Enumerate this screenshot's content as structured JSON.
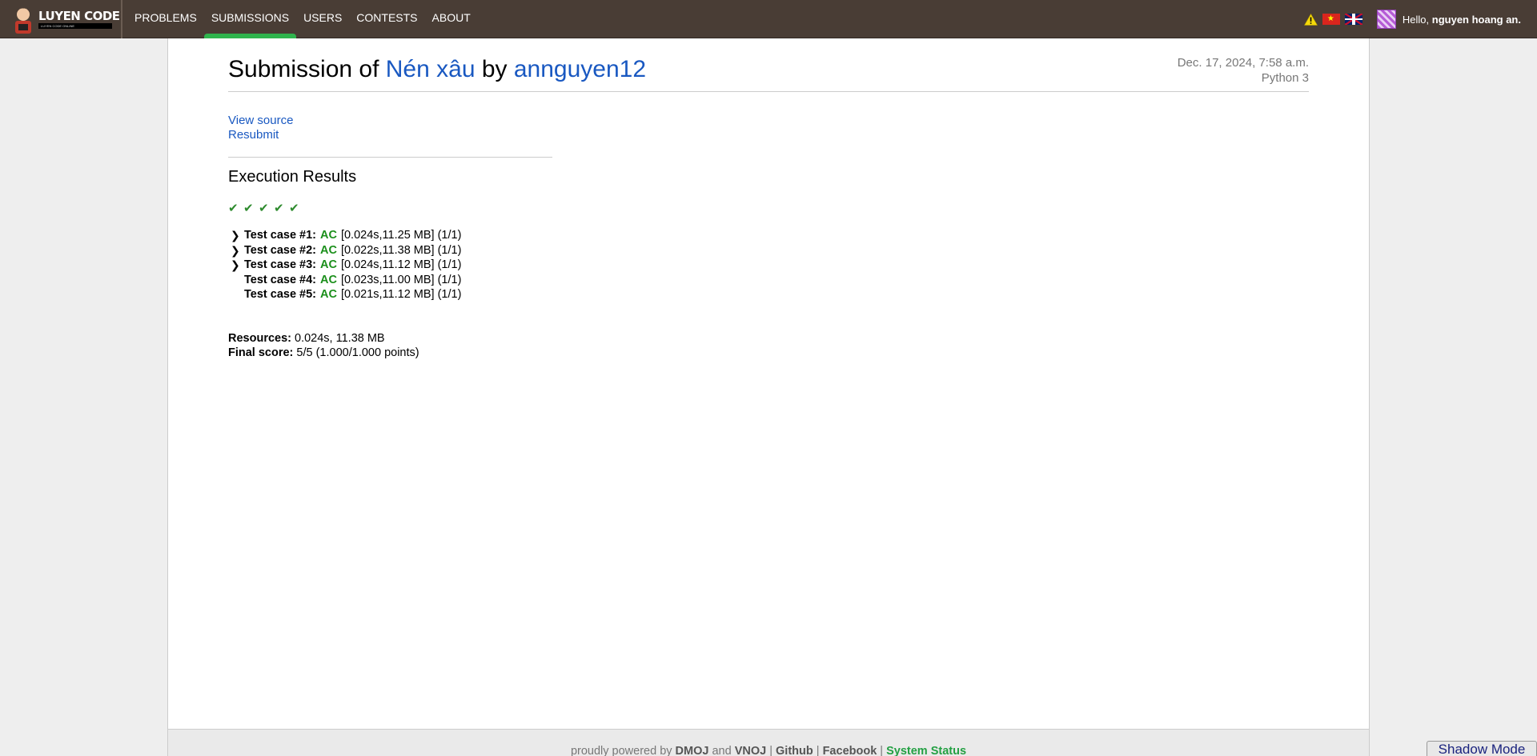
{
  "navbar": {
    "logo_title": "LUYEN CODE",
    "logo_tagline": "LUYEN CODE ONLINE",
    "links": [
      {
        "label": "PROBLEMS"
      },
      {
        "label": "SUBMISSIONS"
      },
      {
        "label": "USERS"
      },
      {
        "label": "CONTESTS"
      },
      {
        "label": "ABOUT"
      }
    ],
    "active_link": "SUBMISSIONS",
    "accent_color": "#2fb44d",
    "greeting_prefix": "Hello, ",
    "username": "nguyen hoang an."
  },
  "submission": {
    "title_prefix": "Submission of ",
    "problem_name": "Nén xâu",
    "title_by": " by ",
    "author": "annguyen12",
    "date": "Dec. 17, 2024, 7:58 a.m.",
    "language": "Python 3",
    "view_source": "View source",
    "resubmit": "Resubmit"
  },
  "results": {
    "heading": "Execution Results",
    "check_count": 5,
    "cases": [
      {
        "label": "Test case #1:",
        "status": "AC",
        "detail": "[0.024s,11.25 MB] (1/1)",
        "expandable": true
      },
      {
        "label": "Test case #2:",
        "status": "AC",
        "detail": "[0.022s,11.38 MB] (1/1)",
        "expandable": true
      },
      {
        "label": "Test case #3:",
        "status": "AC",
        "detail": "[0.024s,11.12 MB] (1/1)",
        "expandable": true
      },
      {
        "label": "Test case #4:",
        "status": "AC",
        "detail": "[0.023s,11.00 MB] (1/1)",
        "expandable": false
      },
      {
        "label": "Test case #5:",
        "status": "AC",
        "detail": "[0.021s,11.12 MB] (1/1)",
        "expandable": false
      }
    ],
    "resources_label": "Resources:",
    "resources_value": "0.024s, 11.38 MB",
    "final_score_label": "Final score:",
    "final_score_value": "5/5 (1.000/1.000 points)"
  },
  "footer": {
    "prefix": "proudly powered by ",
    "dmoj": "DMOJ",
    "and": " and ",
    "vnoj": "VNOJ",
    "sep": " | ",
    "github": "Github",
    "facebook": "Facebook",
    "system_status": "System Status"
  },
  "shadow_mode": "Shadow Mode",
  "icons": {
    "warning": "warning-icon",
    "check": "check-icon",
    "chevron": "chevron-right-icon"
  }
}
